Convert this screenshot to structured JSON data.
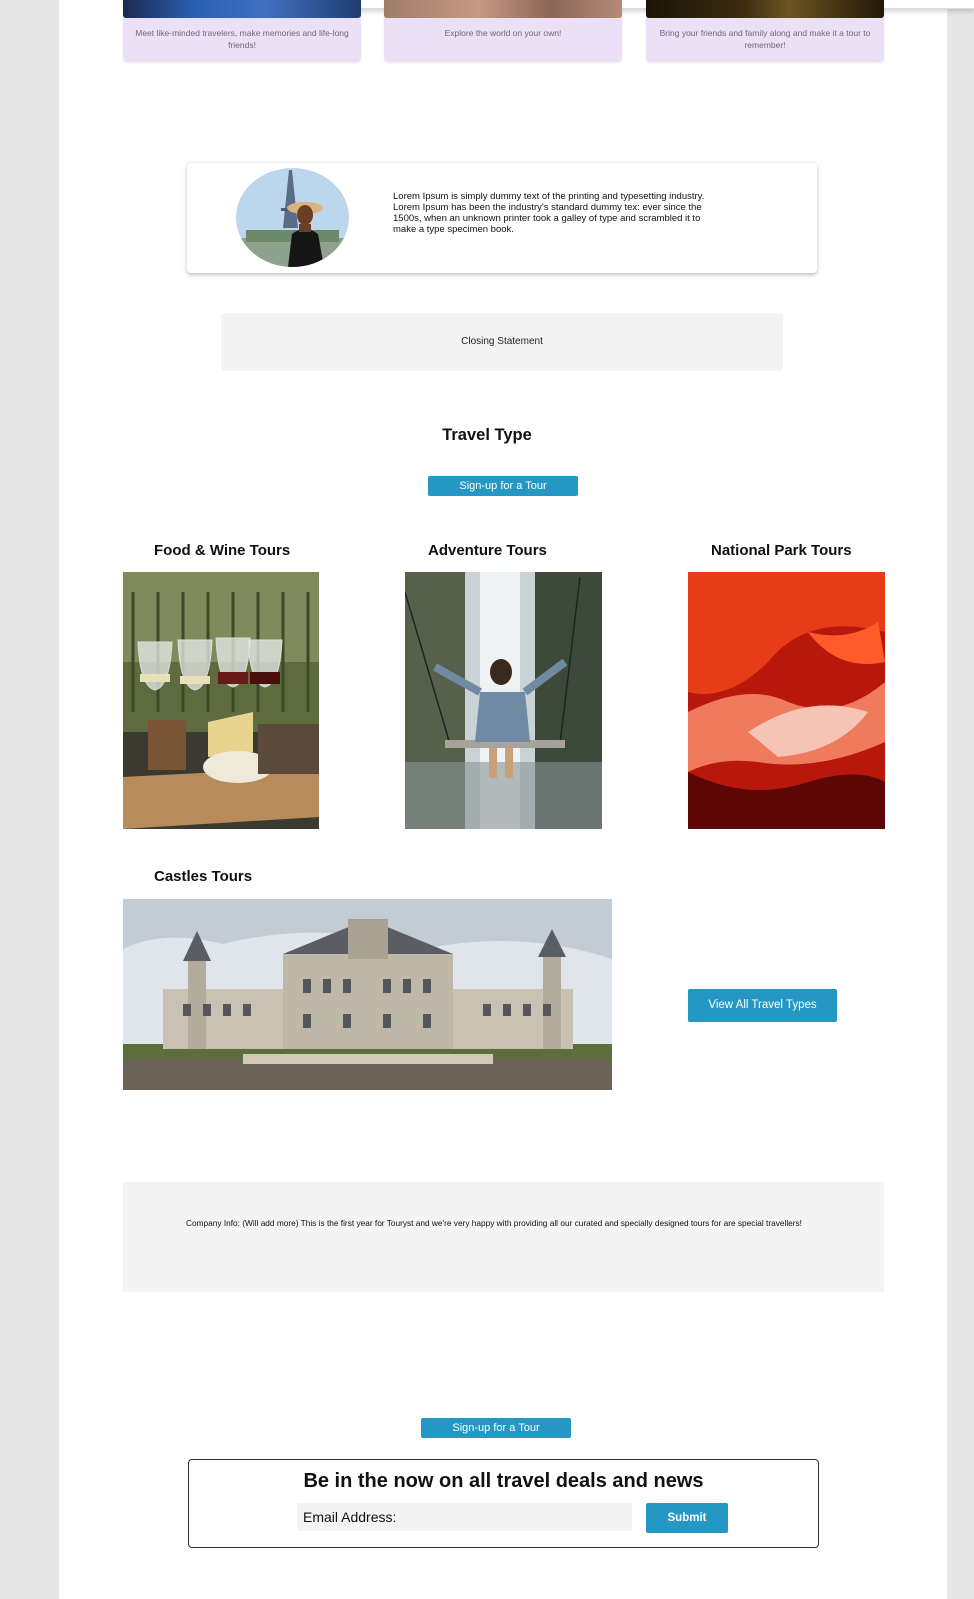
{
  "features": [
    {
      "text": "Meet like-minded travelers, make memories and life-long friends!"
    },
    {
      "text": "Explore the world on your own!"
    },
    {
      "text": "Bring your friends and family along and make it a tour to remember!"
    }
  ],
  "testimonial": {
    "text": "Lorem Ipsum is simply dummy text of the printing and typesetting industry. Lorem Ipsum has been the industry's standard dummy tex: ever since the 1500s, when an unknown printer took a galley of type and scrambled it to make a type specimen book."
  },
  "closing": {
    "text": "Closing  Statement"
  },
  "travel_type": {
    "title": "Travel Type",
    "signup_label": "Sign-up for a Tour"
  },
  "tours": [
    {
      "title": "Food & Wine Tours"
    },
    {
      "title": "Adventure Tours"
    },
    {
      "title": "National Park Tours"
    },
    {
      "title": "Castles Tours"
    }
  ],
  "view_all_label": "View All Travel Types",
  "company_info": "Company Info: (Will add more) This is the first year for Touryst and we're very happy with providing all our curated and specially designed  tours for are special travellers!",
  "signup_bottom_label": "Sign-up for a Tour",
  "newsletter": {
    "title": "Be in the now on all travel deals and news",
    "email_placeholder": "Email Address:",
    "submit_label": "Submit"
  },
  "colors": {
    "accent": "#2497c4",
    "feature_card": "#ece0f6",
    "panel": "#f5f4f5"
  }
}
